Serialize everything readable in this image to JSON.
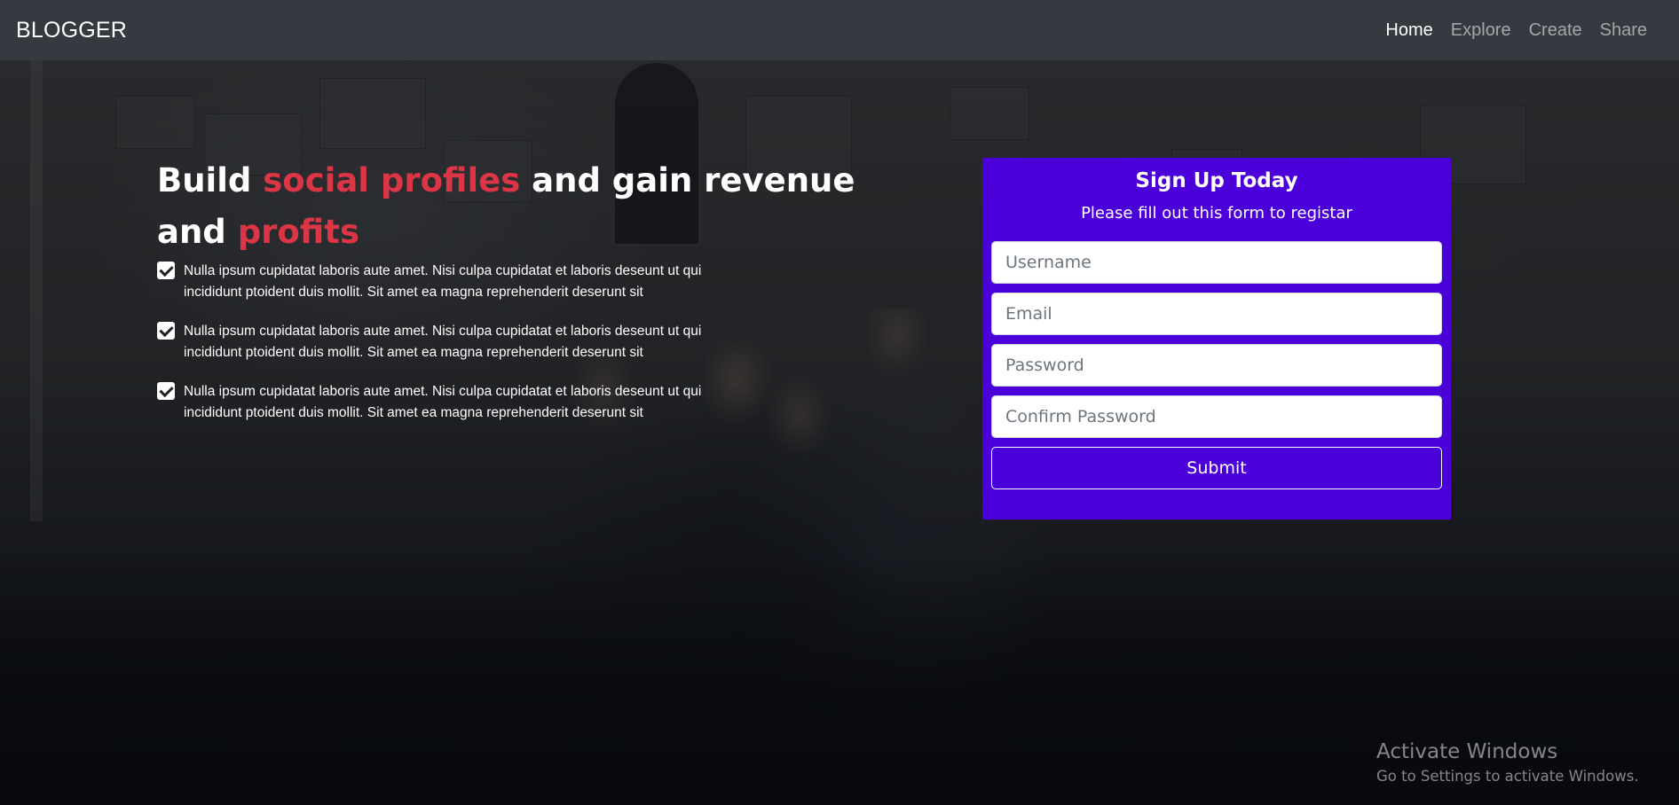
{
  "navbar": {
    "brand": "BLOGGER",
    "links": [
      {
        "label": "Home",
        "active": true
      },
      {
        "label": "Explore",
        "active": false
      },
      {
        "label": "Create",
        "active": false
      },
      {
        "label": "Share",
        "active": false
      }
    ]
  },
  "hero": {
    "headline_part1": "Build ",
    "headline_accent1": "social profiles",
    "headline_part2": " and gain revenue and ",
    "headline_accent2": "profits",
    "features": [
      "Nulla ipsum cupidatat laboris aute amet. Nisi culpa cupidatat et laboris deseunt ut qui incididunt ptoident duis mollit. Sit amet ea magna reprehenderit deserunt sit",
      "Nulla ipsum cupidatat laboris aute amet. Nisi culpa cupidatat et laboris deseunt ut qui incididunt ptoident duis mollit. Sit amet ea magna reprehenderit deserunt sit",
      "Nulla ipsum cupidatat laboris aute amet. Nisi culpa cupidatat et laboris deseunt ut qui incididunt ptoident duis mollit. Sit amet ea magna reprehenderit deserunt sit"
    ]
  },
  "signup": {
    "title": "Sign Up Today",
    "subtitle": "Please fill out this form to registar",
    "username_placeholder": "Username",
    "email_placeholder": "Email",
    "password_placeholder": "Password",
    "confirm_placeholder": "Confirm Password",
    "submit_label": "Submit"
  },
  "watermark": {
    "title": "Activate Windows",
    "subtitle": "Go to Settings to activate Windows."
  },
  "colors": {
    "navbar_bg": "#343a40",
    "accent_red": "#dc3545",
    "card_purple": "#4c00d9"
  },
  "icons": [
    "checkbox-checked-icon"
  ]
}
